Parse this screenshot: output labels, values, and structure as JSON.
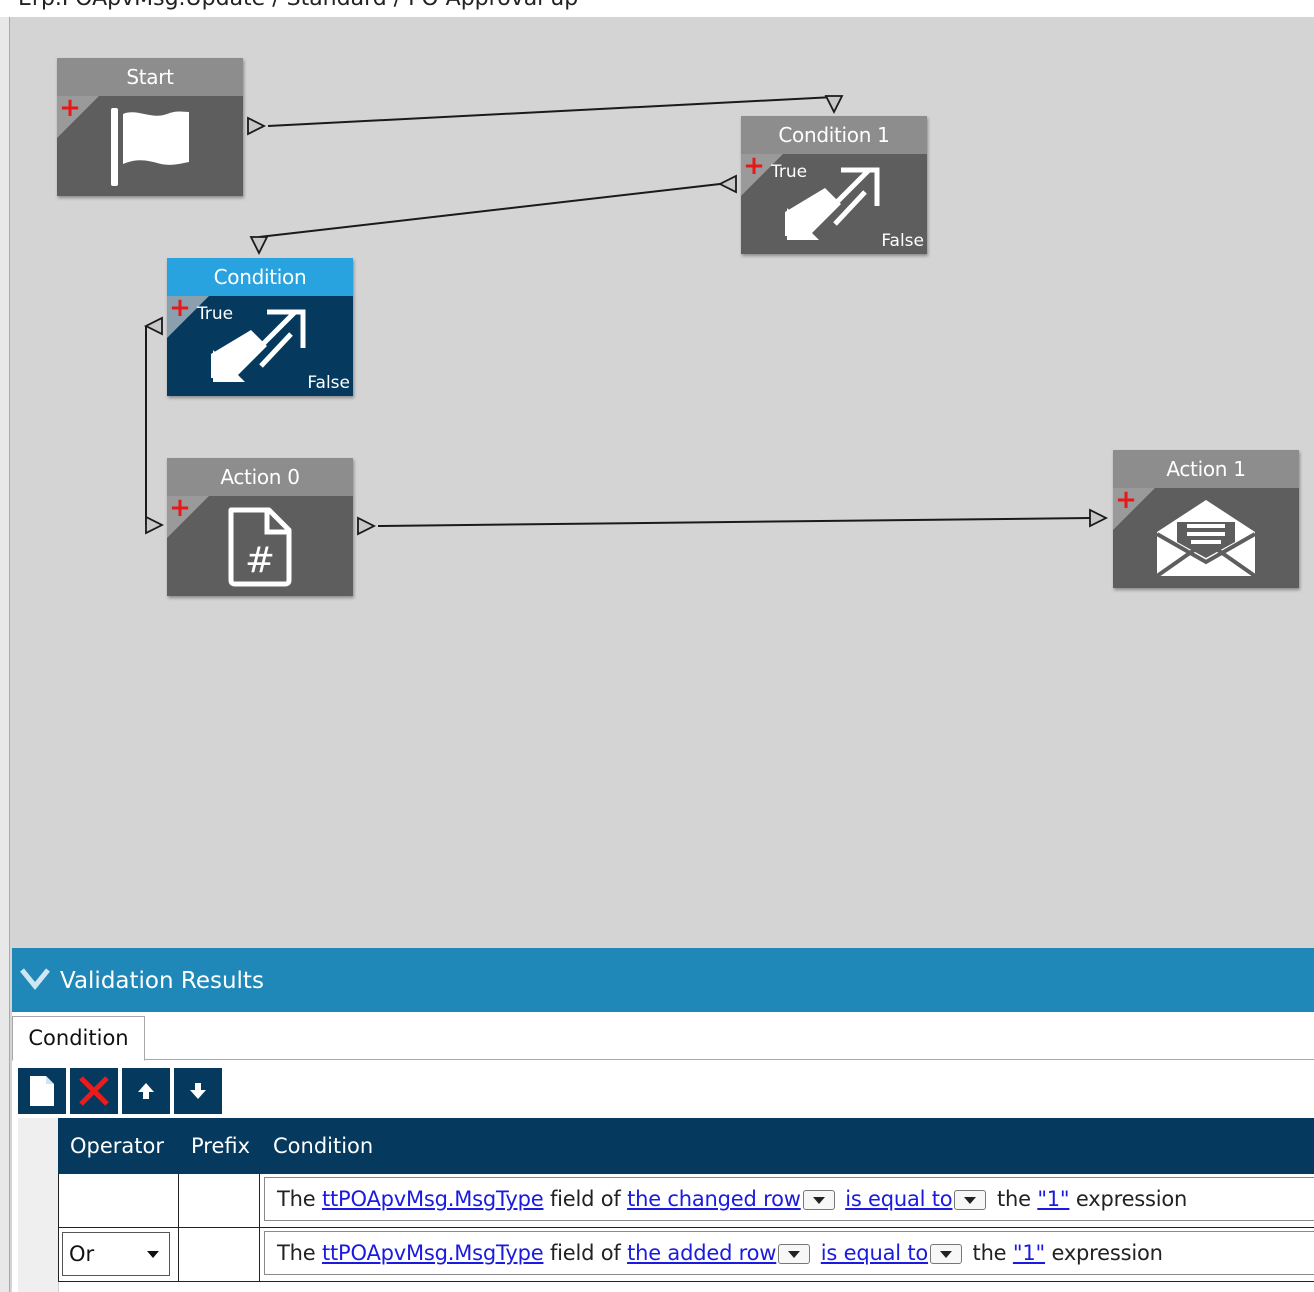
{
  "window": {
    "title": "Erp.POApvMsg.Update / Standard / PO Approval up"
  },
  "workflow": {
    "nodes": {
      "start": {
        "title": "Start",
        "icon": "flag-icon"
      },
      "condition1": {
        "title": "Condition 1",
        "true_label": "True",
        "false_label": "False",
        "icon": "branch-arrows-icon"
      },
      "condition": {
        "title": "Condition",
        "true_label": "True",
        "false_label": "False",
        "icon": "branch-arrows-icon",
        "selected": true
      },
      "action0": {
        "title": "Action 0",
        "icon": "hash-document-icon"
      },
      "action1": {
        "title": "Action 1",
        "icon": "open-envelope-icon"
      }
    },
    "colors": {
      "node_header": "#8d8d8d",
      "node_body": "#5e5e5e",
      "selected_header": "#29a3e0",
      "selected_body": "#053a5e",
      "add_plus": "#e81818"
    }
  },
  "validation": {
    "panel_title": "Validation Results",
    "tabs": [
      "Condition"
    ],
    "toolbar": {
      "new": "new-document-icon",
      "delete": "delete-x-icon",
      "move_up": "arrow-up-icon",
      "move_down": "arrow-down-icon"
    },
    "grid": {
      "columns": {
        "operator": "Operator",
        "prefix": "Prefix",
        "condition": "Condition"
      },
      "rows": [
        {
          "operator": "",
          "prefix": "",
          "parts": {
            "t1": "The",
            "field": "ttPOApvMsg.MsgType",
            "t2": "field of",
            "row": "the changed row",
            "op": "is equal to",
            "t3": "the",
            "value": "\"1\"",
            "t4": "expression"
          }
        },
        {
          "operator": "Or",
          "prefix": "",
          "parts": {
            "t1": "The",
            "field": "ttPOApvMsg.MsgType",
            "t2": "field of",
            "row": "the added row",
            "op": "is equal to",
            "t3": "the",
            "value": "\"1\"",
            "t4": "expression"
          }
        }
      ]
    }
  }
}
